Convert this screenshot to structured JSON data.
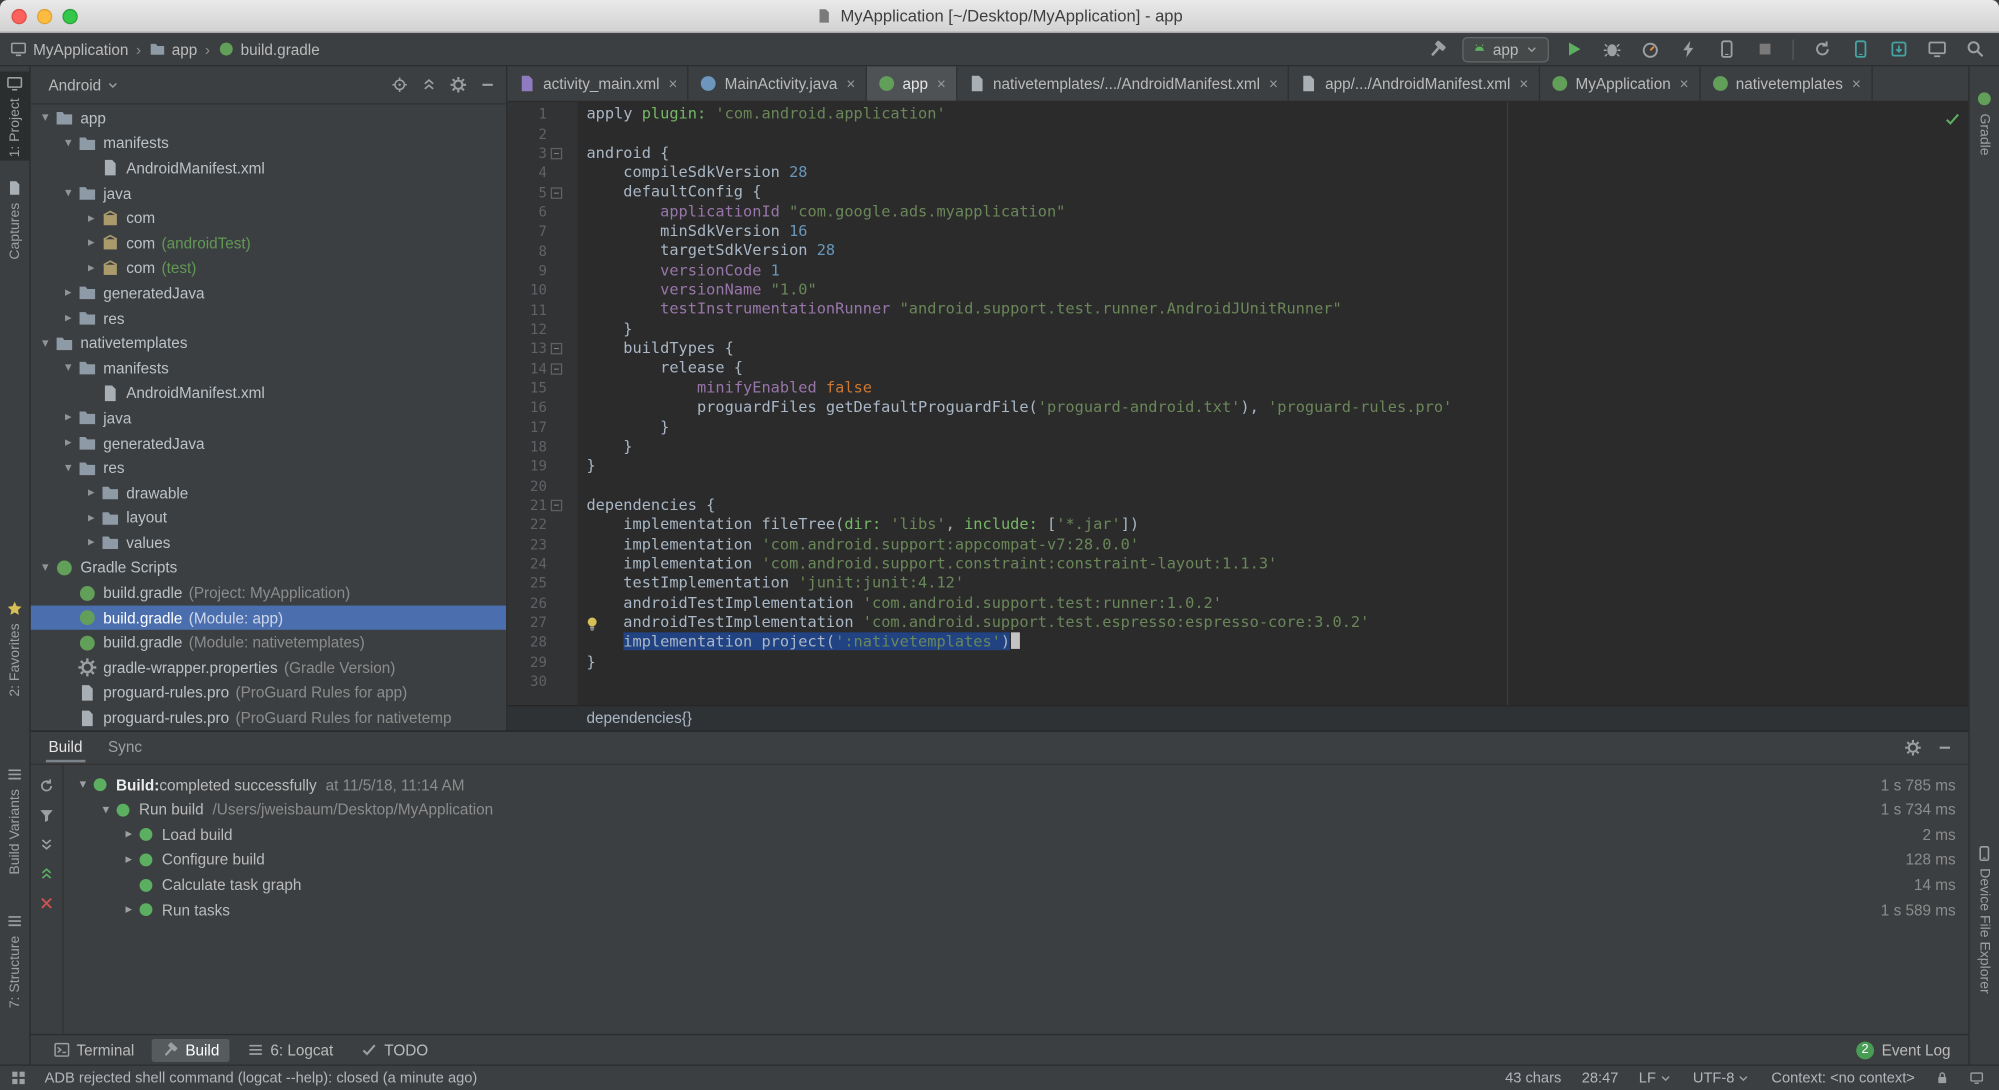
{
  "colors": {
    "selection_blue": "#4b6eaf",
    "editor_selection": "#214283",
    "run_green": "#5caf60",
    "error_red": "#c75450",
    "string_green": "#6a8759",
    "number_blue": "#6897bb",
    "keyword_orange": "#cc7832",
    "property_purple": "#9876aa"
  },
  "titlebar": {
    "title": "MyApplication [~/Desktop/MyApplication] - app"
  },
  "toolbar": {
    "breadcrumbs": [
      {
        "icon": "monitor",
        "label": "MyApplication"
      },
      {
        "icon": "folder",
        "label": "app"
      },
      {
        "icon": "gradle",
        "label": "build.gradle"
      }
    ],
    "run_config": "app"
  },
  "left_strip": [
    {
      "label": "1: Project",
      "icon": "monitor",
      "selected": true
    },
    {
      "label": "Captures",
      "icon": "file"
    },
    {
      "label": "2: Favorites",
      "icon": "star"
    },
    {
      "label": "Build Variants",
      "icon": "list"
    },
    {
      "label": "7: Structure",
      "icon": "list"
    }
  ],
  "right_strip": [
    {
      "label": "Gradle",
      "icon": "gradle"
    },
    {
      "label": "Device File Explorer",
      "icon": "phone"
    }
  ],
  "project_panel": {
    "view": "Android",
    "tree": [
      {
        "depth": 0,
        "arrow": "down",
        "icon": "module",
        "label": "app"
      },
      {
        "depth": 1,
        "arrow": "down",
        "icon": "folder",
        "label": "manifests"
      },
      {
        "depth": 2,
        "arrow": "none",
        "icon": "manifest",
        "label": "AndroidManifest.xml"
      },
      {
        "depth": 1,
        "arrow": "down",
        "icon": "folder",
        "label": "java"
      },
      {
        "depth": 2,
        "arrow": "right",
        "icon": "package",
        "label": "com"
      },
      {
        "depth": 2,
        "arrow": "right",
        "icon": "package",
        "label": "com",
        "suffix": " (androidTest)",
        "suffix_style": "test"
      },
      {
        "depth": 2,
        "arrow": "right",
        "icon": "package",
        "label": "com",
        "suffix": " (test)",
        "suffix_style": "test"
      },
      {
        "depth": 1,
        "arrow": "right",
        "icon": "folder",
        "label": "generatedJava"
      },
      {
        "depth": 1,
        "arrow": "right",
        "icon": "folder",
        "label": "res"
      },
      {
        "depth": 0,
        "arrow": "down",
        "icon": "module",
        "label": "nativetemplates"
      },
      {
        "depth": 1,
        "arrow": "down",
        "icon": "folder",
        "label": "manifests"
      },
      {
        "depth": 2,
        "arrow": "none",
        "icon": "manifest",
        "label": "AndroidManifest.xml"
      },
      {
        "depth": 1,
        "arrow": "right",
        "icon": "folder",
        "label": "java"
      },
      {
        "depth": 1,
        "arrow": "right",
        "icon": "folder",
        "label": "generatedJava"
      },
      {
        "depth": 1,
        "arrow": "down",
        "icon": "folder",
        "label": "res"
      },
      {
        "depth": 2,
        "arrow": "right",
        "icon": "folder",
        "label": "drawable"
      },
      {
        "depth": 2,
        "arrow": "right",
        "icon": "folder",
        "label": "layout"
      },
      {
        "depth": 2,
        "arrow": "right",
        "icon": "folder",
        "label": "values"
      },
      {
        "depth": 0,
        "arrow": "down",
        "icon": "gradle",
        "label": "Gradle Scripts"
      },
      {
        "depth": 1,
        "arrow": "none",
        "icon": "gradle",
        "label": "build.gradle",
        "suffix": " (Project: MyApplication)"
      },
      {
        "depth": 1,
        "arrow": "none",
        "icon": "gradle",
        "label": "build.gradle",
        "suffix": " (Module: app)",
        "selected": true
      },
      {
        "depth": 1,
        "arrow": "none",
        "icon": "gradle",
        "label": "build.gradle",
        "suffix": " (Module: nativetemplates)"
      },
      {
        "depth": 1,
        "arrow": "none",
        "icon": "gradle-wrapper",
        "label": "gradle-wrapper.properties",
        "suffix": " (Gradle Version)"
      },
      {
        "depth": 1,
        "arrow": "none",
        "icon": "file",
        "label": "proguard-rules.pro",
        "suffix": " (ProGuard Rules for app)"
      },
      {
        "depth": 1,
        "arrow": "none",
        "icon": "file",
        "label": "proguard-rules.pro",
        "suffix": " (ProGuard Rules for nativetemp"
      }
    ]
  },
  "editor_tabs": [
    {
      "icon": "layout-file",
      "label": "activity_main.xml"
    },
    {
      "icon": "java-class",
      "label": "MainActivity.java"
    },
    {
      "icon": "gradle",
      "label": "app",
      "selected": true
    },
    {
      "icon": "manifest",
      "label": "nativetemplates/.../AndroidManifest.xml"
    },
    {
      "icon": "manifest",
      "label": "app/.../AndroidManifest.xml"
    },
    {
      "icon": "gradle",
      "label": "MyApplication"
    },
    {
      "icon": "gradle",
      "label": "nativetemplates"
    }
  ],
  "editor": {
    "breadcrumb": "dependencies{}",
    "fold_lines": [
      3,
      5,
      13,
      14,
      21
    ],
    "lines": [
      {
        "segs": [
          [
            "apply ",
            "p"
          ],
          [
            "plugin: ",
            "k"
          ],
          [
            "'com.android.application'",
            "s"
          ]
        ]
      },
      {
        "segs": []
      },
      {
        "segs": [
          [
            "android {",
            "p"
          ]
        ]
      },
      {
        "segs": [
          [
            "    compileSdkVersion ",
            "p"
          ],
          [
            "28",
            "n"
          ]
        ]
      },
      {
        "segs": [
          [
            "    defaultConfig {",
            "p"
          ]
        ]
      },
      {
        "segs": [
          [
            "        ",
            "p"
          ],
          [
            "applicationId ",
            "prop"
          ],
          [
            "\"com.google.ads.myapplication\"",
            "s"
          ]
        ]
      },
      {
        "segs": [
          [
            "        minSdkVersion ",
            "p"
          ],
          [
            "16",
            "n"
          ]
        ]
      },
      {
        "segs": [
          [
            "        targetSdkVersion ",
            "p"
          ],
          [
            "28",
            "n"
          ]
        ]
      },
      {
        "segs": [
          [
            "        ",
            "p"
          ],
          [
            "versionCode ",
            "prop"
          ],
          [
            "1",
            "n"
          ]
        ]
      },
      {
        "segs": [
          [
            "        ",
            "p"
          ],
          [
            "versionName ",
            "prop"
          ],
          [
            "\"1.0\"",
            "s"
          ]
        ]
      },
      {
        "segs": [
          [
            "        ",
            "p"
          ],
          [
            "testInstrumentationRunner ",
            "prop"
          ],
          [
            "\"android.support.test.runner.AndroidJUnitRunner\"",
            "s"
          ]
        ]
      },
      {
        "segs": [
          [
            "    }",
            "p"
          ]
        ]
      },
      {
        "segs": [
          [
            "    buildTypes {",
            "p"
          ]
        ]
      },
      {
        "segs": [
          [
            "        release {",
            "p"
          ]
        ]
      },
      {
        "segs": [
          [
            "            ",
            "p"
          ],
          [
            "minifyEnabled ",
            "prop"
          ],
          [
            "false",
            "kw"
          ]
        ]
      },
      {
        "segs": [
          [
            "            proguardFiles getDefaultProguardFile(",
            "p"
          ],
          [
            "'proguard-android.txt'",
            "s"
          ],
          [
            "), ",
            "p"
          ],
          [
            "'proguard-rules.pro'",
            "s"
          ]
        ]
      },
      {
        "segs": [
          [
            "        }",
            "p"
          ]
        ]
      },
      {
        "segs": [
          [
            "    }",
            "p"
          ]
        ]
      },
      {
        "segs": [
          [
            "}",
            "p"
          ]
        ]
      },
      {
        "segs": []
      },
      {
        "segs": [
          [
            "dependencies {",
            "p"
          ]
        ]
      },
      {
        "segs": [
          [
            "    implementation fileTree(",
            "p"
          ],
          [
            "dir: ",
            "k"
          ],
          [
            "'libs'",
            "s"
          ],
          [
            ", ",
            "p"
          ],
          [
            "include: ",
            "k"
          ],
          [
            "[",
            "p"
          ],
          [
            "'*.jar'",
            "s"
          ],
          [
            "])",
            "p"
          ]
        ]
      },
      {
        "segs": [
          [
            "    implementation ",
            "p"
          ],
          [
            "'com.android.support:appcompat-v7:28.0.0'",
            "s"
          ]
        ]
      },
      {
        "segs": [
          [
            "    implementation ",
            "p"
          ],
          [
            "'com.android.support.constraint:constraint-layout:1.1.3'",
            "s"
          ]
        ]
      },
      {
        "segs": [
          [
            "    testImplementation ",
            "p"
          ],
          [
            "'junit:junit:4.12'",
            "s"
          ]
        ]
      },
      {
        "segs": [
          [
            "    androidTestImplementation ",
            "p"
          ],
          [
            "'com.android.support.test:runner:1.0.2'",
            "s"
          ]
        ]
      },
      {
        "segs": [
          [
            "    androidTestImplementation ",
            "p"
          ],
          [
            "'com.android.support.test.espresso:espresso-core:3.0.2'",
            "s"
          ]
        ]
      },
      {
        "segs": [
          [
            "    ",
            "p"
          ],
          [
            "implementation project(",
            "p",
            "sel"
          ],
          [
            "':nativetemplates'",
            "s",
            "sel"
          ],
          [
            ")",
            "p",
            "sel"
          ]
        ],
        "caret": true
      },
      {
        "segs": [
          [
            "}",
            "p"
          ]
        ]
      },
      {
        "segs": []
      }
    ]
  },
  "build_panel": {
    "tabs": [
      {
        "label": "Build",
        "selected": true
      },
      {
        "label": "Sync"
      }
    ],
    "rows": [
      {
        "depth": 0,
        "arrow": "down",
        "bold": "Build:",
        "label": " completed successfully",
        "meta": "at 11/5/18, 11:14 AM",
        "time": "1 s 785 ms"
      },
      {
        "depth": 1,
        "arrow": "down",
        "label": "Run build",
        "meta": "/Users/jweisbaum/Desktop/MyApplication",
        "time": "1 s 734 ms"
      },
      {
        "depth": 2,
        "arrow": "right",
        "label": "Load build",
        "time": "2 ms"
      },
      {
        "depth": 2,
        "arrow": "right",
        "label": "Configure build",
        "time": "128 ms"
      },
      {
        "depth": 2,
        "arrow": "none",
        "label": "Calculate task graph",
        "time": "14 ms"
      },
      {
        "depth": 2,
        "arrow": "right",
        "label": "Run tasks",
        "time": "1 s 589 ms"
      }
    ]
  },
  "bottom_bar": {
    "tabs": [
      {
        "icon": "terminal",
        "label": "Terminal"
      },
      {
        "icon": "hammer",
        "label": "Build",
        "selected": true
      },
      {
        "icon": "list",
        "label": "6: Logcat"
      },
      {
        "icon": "check",
        "label": "TODO"
      }
    ],
    "event_log": {
      "label": "Event Log",
      "badge": "2"
    }
  },
  "status_bar": {
    "message": "ADB rejected shell command (logcat --help): closed (a minute ago)",
    "selection_chars": "43 chars",
    "caret_position": "28:47",
    "line_separator": "LF",
    "encoding": "UTF-8",
    "context": "Context: <no context>"
  }
}
